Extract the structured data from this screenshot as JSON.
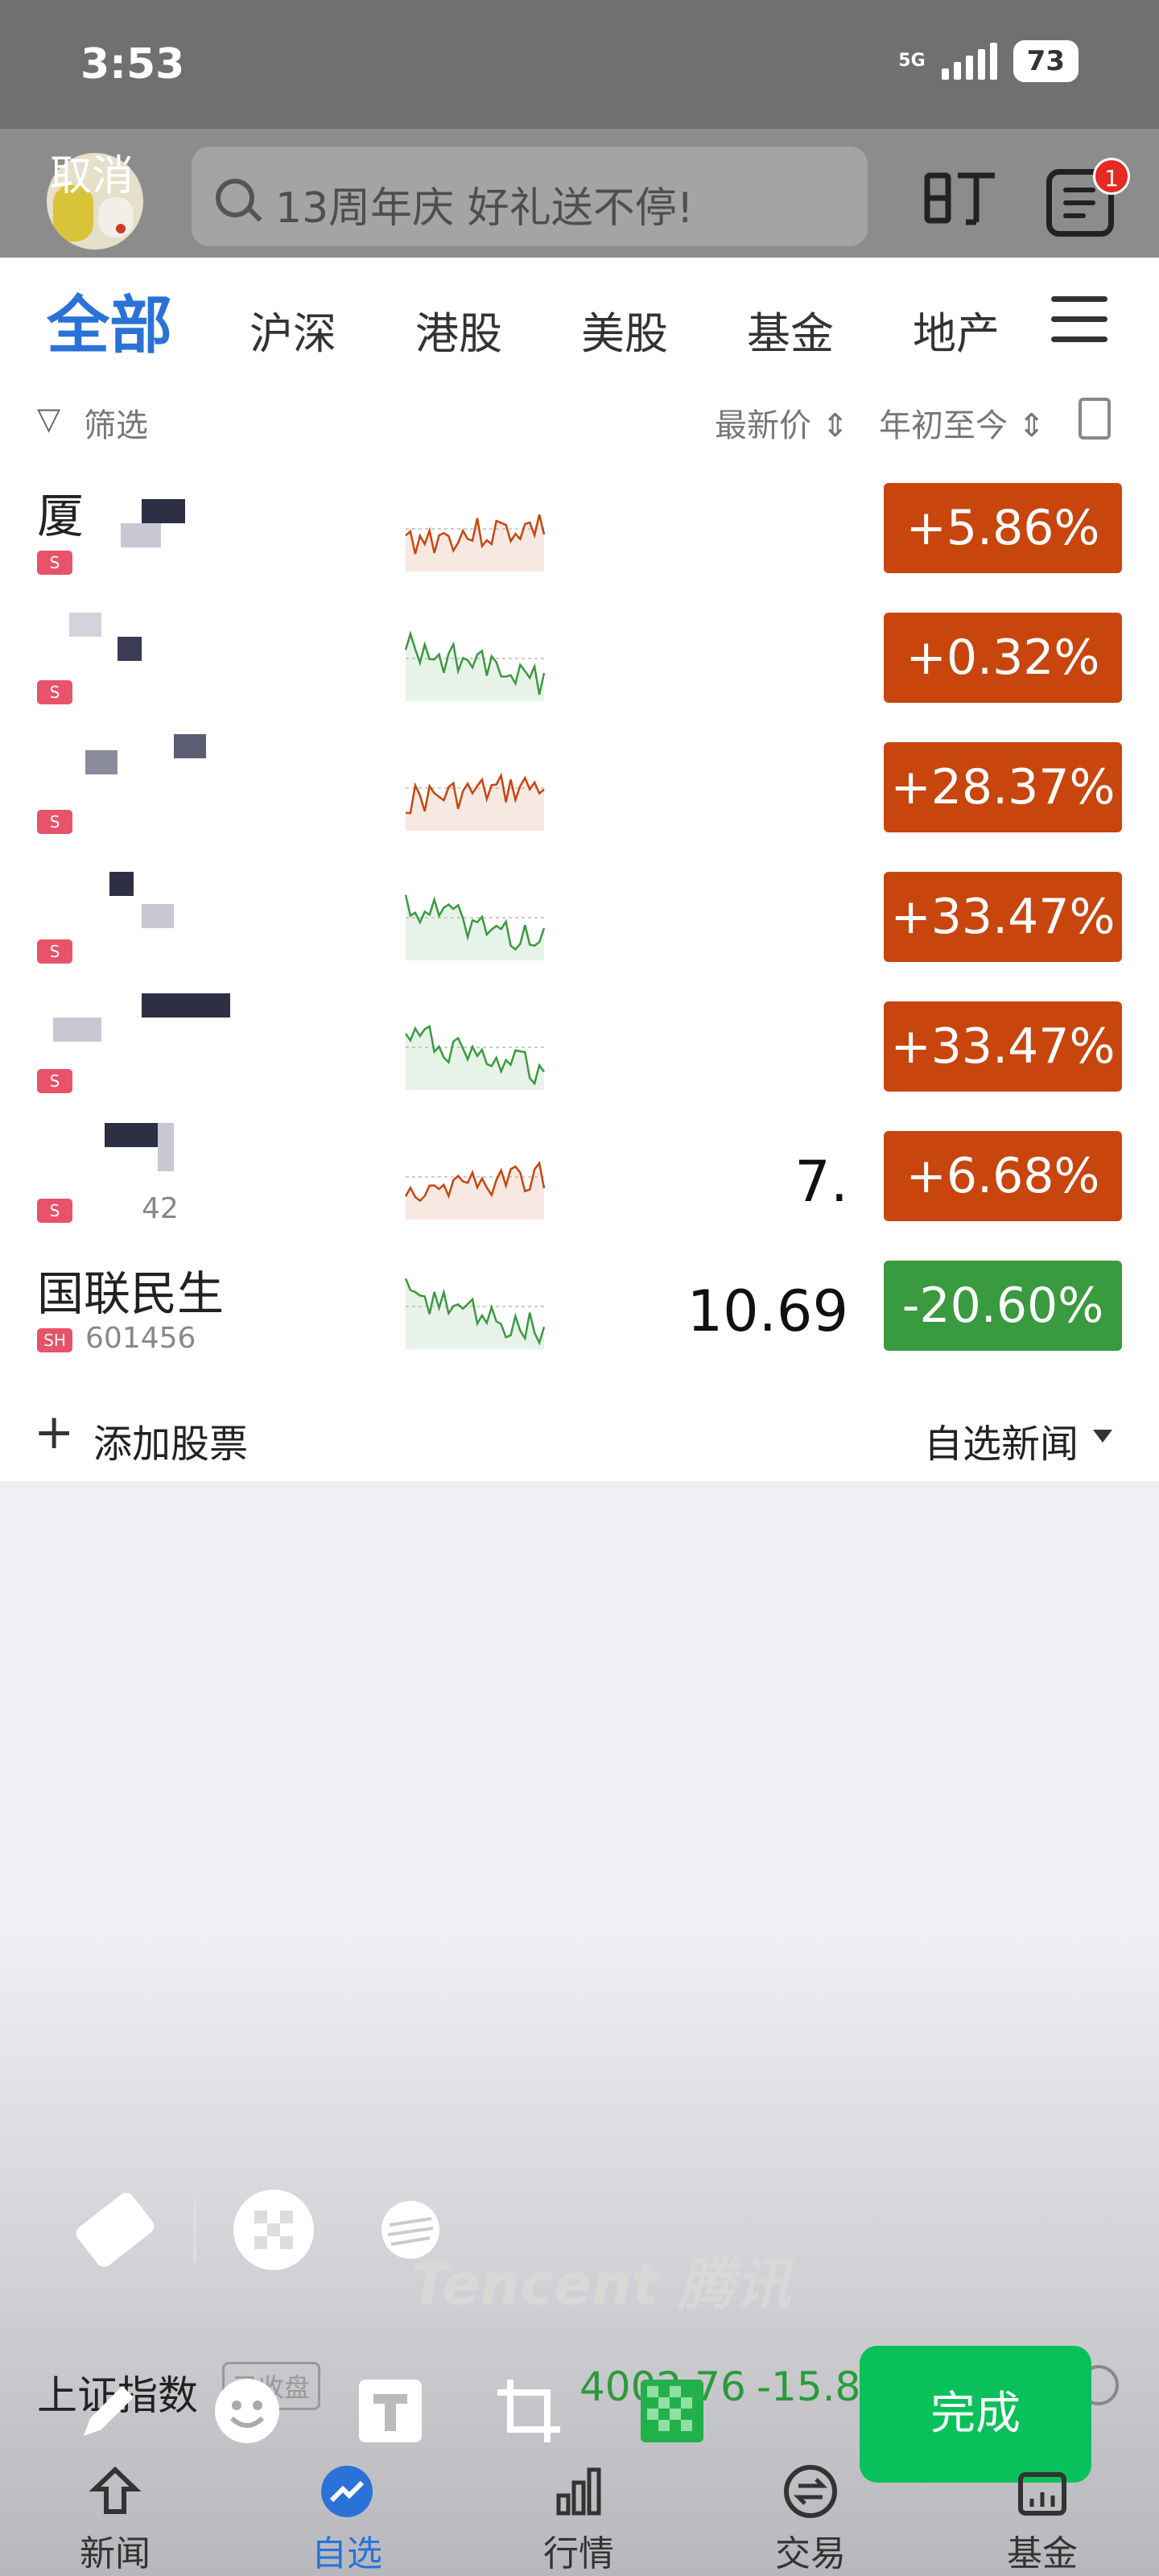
{
  "status_bar": {
    "time": "3:53",
    "network": "5G",
    "battery": "73"
  },
  "top_bar": {
    "cancel_label": "取消",
    "search_placeholder": "13周年庆 好礼送不停!",
    "message_badge": "1"
  },
  "tabs": {
    "all": "全部",
    "shsz": "沪深",
    "hk": "港股",
    "us": "美股",
    "fund": "基金",
    "realestate": "地产"
  },
  "filter": {
    "label": "筛选",
    "sort_price": "最新价",
    "sort_ytd": "年初至今"
  },
  "stocks": [
    {
      "name": "厦",
      "code": "",
      "price": "",
      "change": "+5.86%",
      "trend": "up"
    },
    {
      "name": "",
      "code": "",
      "price": "",
      "change": "+0.32%",
      "trend": "down"
    },
    {
      "name": "",
      "code": "",
      "price": "",
      "change": "+28.37%",
      "trend": "up"
    },
    {
      "name": "",
      "code": "",
      "price": "",
      "change": "+33.47%",
      "trend": "down"
    },
    {
      "name": "",
      "code": "",
      "price": "",
      "change": "+33.47%",
      "trend": "down"
    },
    {
      "name": "",
      "code": "42",
      "price": "7.",
      "change": "+6.68%",
      "trend": "up"
    },
    {
      "name": "国联民生",
      "market": "SH",
      "code": "601456",
      "price": "10.69",
      "change": "-20.60%",
      "trend": "down"
    }
  ],
  "add_bar": {
    "add_label": "添加股票",
    "news_label": "自选新闻"
  },
  "watermark": "Tencent 腾讯",
  "index_bar": {
    "name": "上证指数",
    "status": "已收盘",
    "value": "4002.76",
    "change": "-15.84"
  },
  "done_label": "完成",
  "bottom_nav": {
    "news": "新闻",
    "watchlist": "自选",
    "market": "行情",
    "trade": "交易",
    "fund": "基金"
  },
  "colors": {
    "up": "#c9450e",
    "down": "#3a9a3f",
    "accent": "#2b72d8",
    "done": "#09c15a"
  }
}
